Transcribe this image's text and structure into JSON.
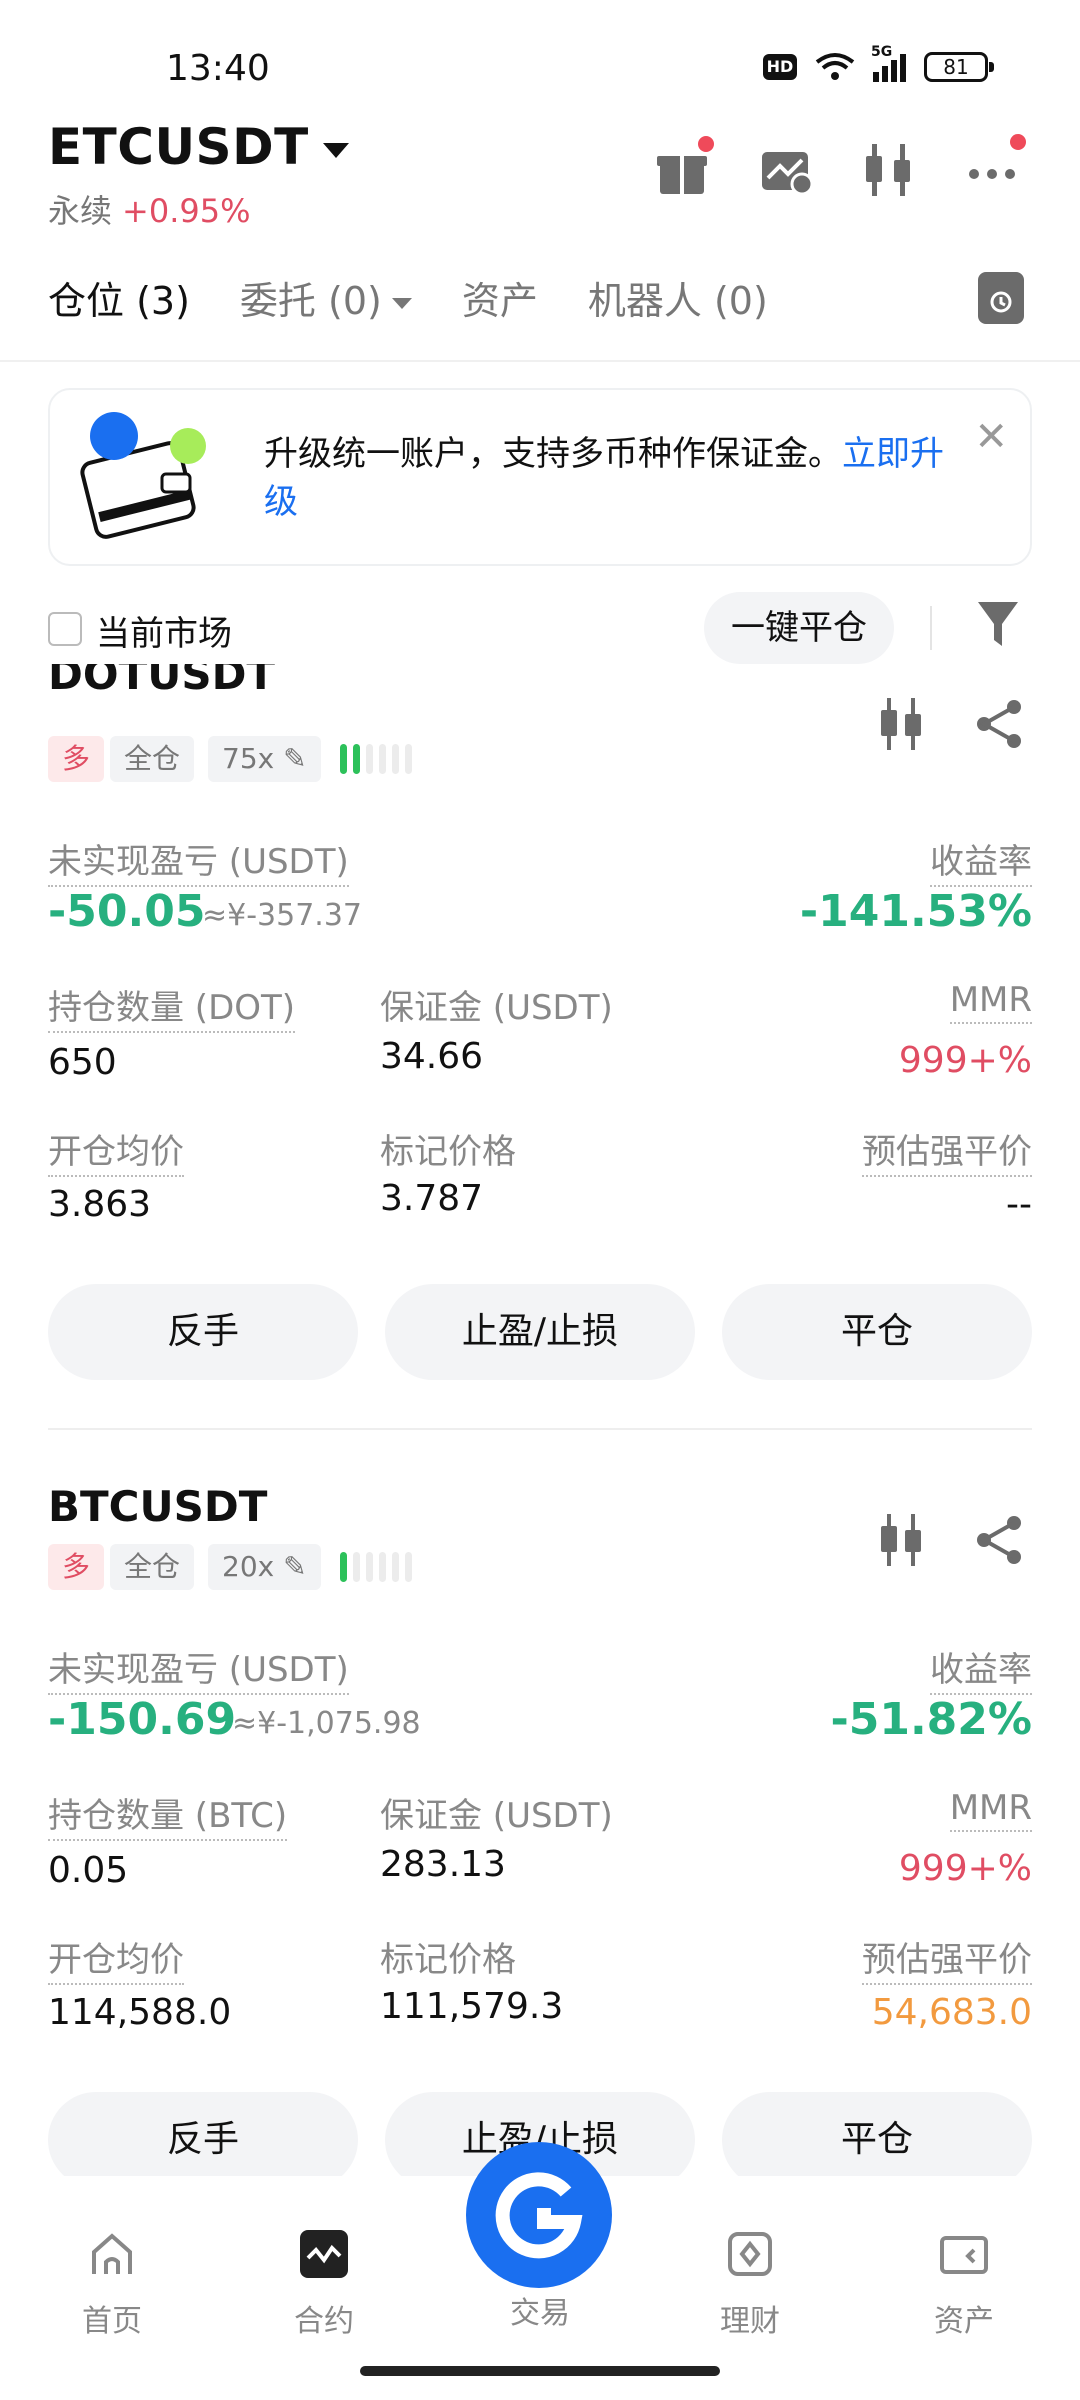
{
  "status_bar": {
    "time": "13:40",
    "hd": "HD",
    "network": "5G",
    "battery": "81"
  },
  "header": {
    "symbol": "ETCUSDT",
    "contract_type": "永续",
    "change": "+0.95%",
    "icons": [
      "gift-icon",
      "chart-settings-icon",
      "candlestick-icon",
      "more-icon"
    ]
  },
  "tabs": [
    {
      "label": "仓位 (3)",
      "active": true
    },
    {
      "label": "委托 (0)",
      "active": false
    },
    {
      "label": "资产",
      "active": false
    },
    {
      "label": "机器人 (0)",
      "active": false
    }
  ],
  "banner": {
    "text": "升级统一账户，支持多币种作保证金。",
    "link": "立即升级"
  },
  "filter": {
    "current_market": "当前市场",
    "close_all": "一键平仓"
  },
  "positions": [
    {
      "symbol": "DOTUSDT",
      "side": "多",
      "margin_mode": "全仓",
      "leverage": "75x",
      "risk_level": 2,
      "pnl_label": "未实现盈亏 (USDT)",
      "pnl": "-50.05",
      "pnl_cny": "≈¥-357.37",
      "roe_label": "收益率",
      "roe": "-141.53%",
      "qty_label": "持仓数量 (DOT)",
      "qty": "650",
      "margin_label": "保证金 (USDT)",
      "margin": "34.66",
      "mmr_label": "MMR",
      "mmr": "999+%",
      "entry_label": "开仓均价",
      "entry": "3.863",
      "mark_label": "标记价格",
      "mark": "3.787",
      "liq_label": "预估强平价",
      "liq": "--",
      "buttons": [
        "反手",
        "止盈/止损",
        "平仓"
      ]
    },
    {
      "symbol": "BTCUSDT",
      "side": "多",
      "margin_mode": "全仓",
      "leverage": "20x",
      "risk_level": 1,
      "pnl_label": "未实现盈亏 (USDT)",
      "pnl": "-150.69",
      "pnl_cny": "≈¥-1,075.98",
      "roe_label": "收益率",
      "roe": "-51.82%",
      "qty_label": "持仓数量 (BTC)",
      "qty": "0.05",
      "margin_label": "保证金 (USDT)",
      "margin": "283.13",
      "mmr_label": "MMR",
      "mmr": "999+%",
      "entry_label": "开仓均价",
      "entry": "114,588.0",
      "mark_label": "标记价格",
      "mark": "111,579.3",
      "liq_label": "预估强平价",
      "liq": "54,683.0",
      "buttons": [
        "反手",
        "止盈/止损",
        "平仓"
      ]
    }
  ],
  "nav": [
    {
      "label": "首页",
      "icon": "home-icon"
    },
    {
      "label": "合约",
      "icon": "futures-icon"
    },
    {
      "label": "交易",
      "icon": "trade-icon"
    },
    {
      "label": "理财",
      "icon": "earn-icon"
    },
    {
      "label": "资产",
      "icon": "wallet-icon"
    }
  ],
  "colors": {
    "accent": "#1a6ff0",
    "loss": "#27b07f",
    "alert": "#e04d63",
    "warn": "#f29a3f"
  }
}
